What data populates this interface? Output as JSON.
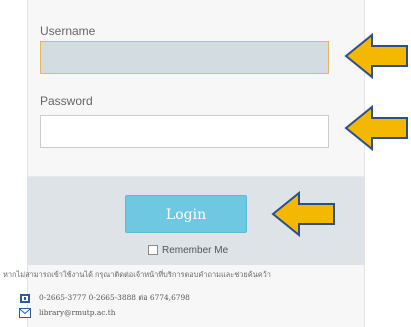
{
  "login_form": {
    "username_label": "Username",
    "username_value": "",
    "password_label": "Password",
    "password_value": "",
    "login_button": "Login",
    "remember_label": "Remember Me",
    "remember_checked": false
  },
  "footer": {
    "notice": "หากไม่สามารถเข้าใช้งานได้ กรุณาติดต่อเจ้าหน้าที่บริการตอบคำถามและช่วยค้นคว้า",
    "phone": "0-2665-3777 0-2665-3888 ต่อ 6774,6798",
    "email": "library@rmutp.ac.th",
    "phone_icon": "phone-icon",
    "email_icon": "mail-icon"
  },
  "annotations": {
    "arrow_icon": "left-pointing-arrow-icon",
    "arrow_fill": "#f5b800",
    "arrow_stroke": "#2b4f8a"
  },
  "colors": {
    "login_button": "#6ec8e2",
    "focused_field_border": "#e2b960",
    "focused_field_bg": "#d3dce1",
    "login_area_bg": "#dde3e6",
    "icon_blue": "#2c5aa0"
  }
}
